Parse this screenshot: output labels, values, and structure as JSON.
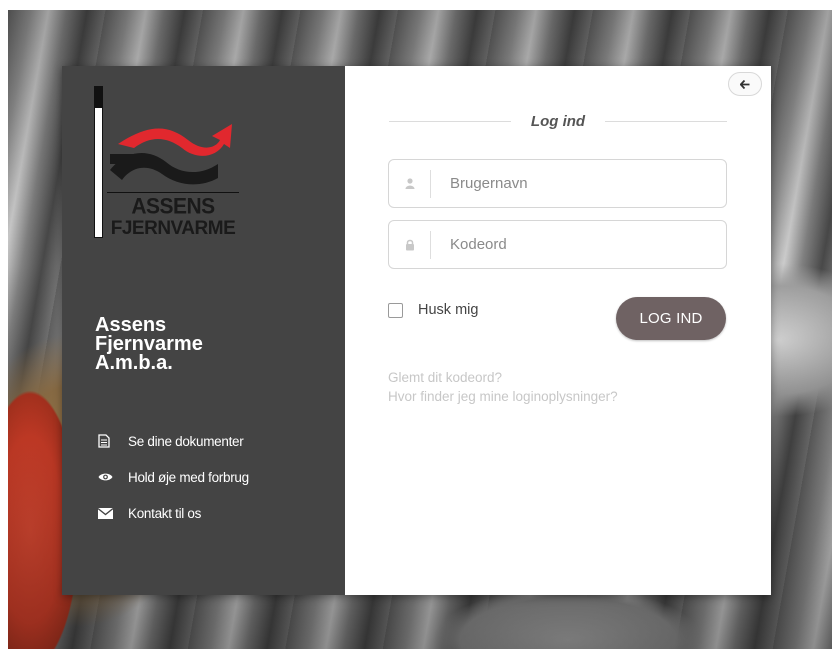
{
  "brand": {
    "logo_line1": "ASSENS",
    "logo_line2": "FJERNVARME",
    "company_line1": "Assens",
    "company_line2": "Fjernvarme",
    "company_line3": "A.m.b.a.",
    "logo_red": "#e1282e",
    "logo_black": "#1a1a1a"
  },
  "nav": {
    "items": [
      {
        "label": "Se dine dokumenter",
        "icon": "document-icon"
      },
      {
        "label": "Hold øje med forbrug",
        "icon": "eye-icon"
      },
      {
        "label": "Kontakt til os",
        "icon": "envelope-icon"
      }
    ]
  },
  "login": {
    "heading": "Log ind",
    "username_placeholder": "Brugernavn",
    "password_placeholder": "Kodeord",
    "remember_label": "Husk mig",
    "submit_label": "LOG IND",
    "forgot_link": "Glemt dit kodeord?",
    "help_link": "Hvor finder jeg mine loginoplysninger?",
    "back_icon": "arrow-left-icon"
  },
  "colors": {
    "left_panel": "#444444",
    "button": "#6f6263",
    "link": "#c7c7c7"
  }
}
